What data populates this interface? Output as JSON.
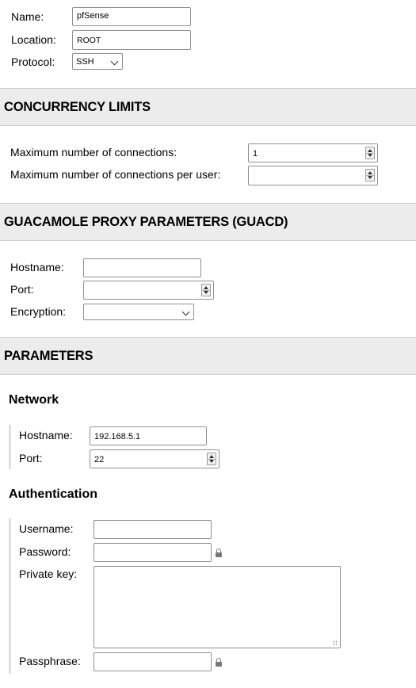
{
  "connection": {
    "name_label": "Name:",
    "name_value": "pfSense",
    "location_label": "Location:",
    "location_value": "ROOT",
    "protocol_label": "Protocol:",
    "protocol_value": "SSH"
  },
  "concurrency": {
    "title": "CONCURRENCY LIMITS",
    "max_conn_label": "Maximum number of connections:",
    "max_conn_value": "1",
    "max_conn_user_label": "Maximum number of connections per user:",
    "max_conn_user_value": ""
  },
  "guacd": {
    "title": "GUACAMOLE PROXY PARAMETERS (GUACD)",
    "hostname_label": "Hostname:",
    "hostname_value": "",
    "port_label": "Port:",
    "port_value": "",
    "encryption_label": "Encryption:",
    "encryption_value": ""
  },
  "parameters": {
    "title": "PARAMETERS",
    "network": {
      "title": "Network",
      "hostname_label": "Hostname:",
      "hostname_value": "192.168.5.1",
      "port_label": "Port:",
      "port_value": "22"
    },
    "authentication": {
      "title": "Authentication",
      "username_label": "Username:",
      "username_value": "",
      "password_label": "Password:",
      "password_value": "",
      "private_key_label": "Private key:",
      "private_key_value": "",
      "passphrase_label": "Passphrase:",
      "passphrase_value": ""
    }
  },
  "icons": {
    "dropdown": "chevron-down-icon",
    "spinner": "spinner-arrows-icon",
    "lock": "lock-icon",
    "resize": "resize-grip-icon"
  }
}
